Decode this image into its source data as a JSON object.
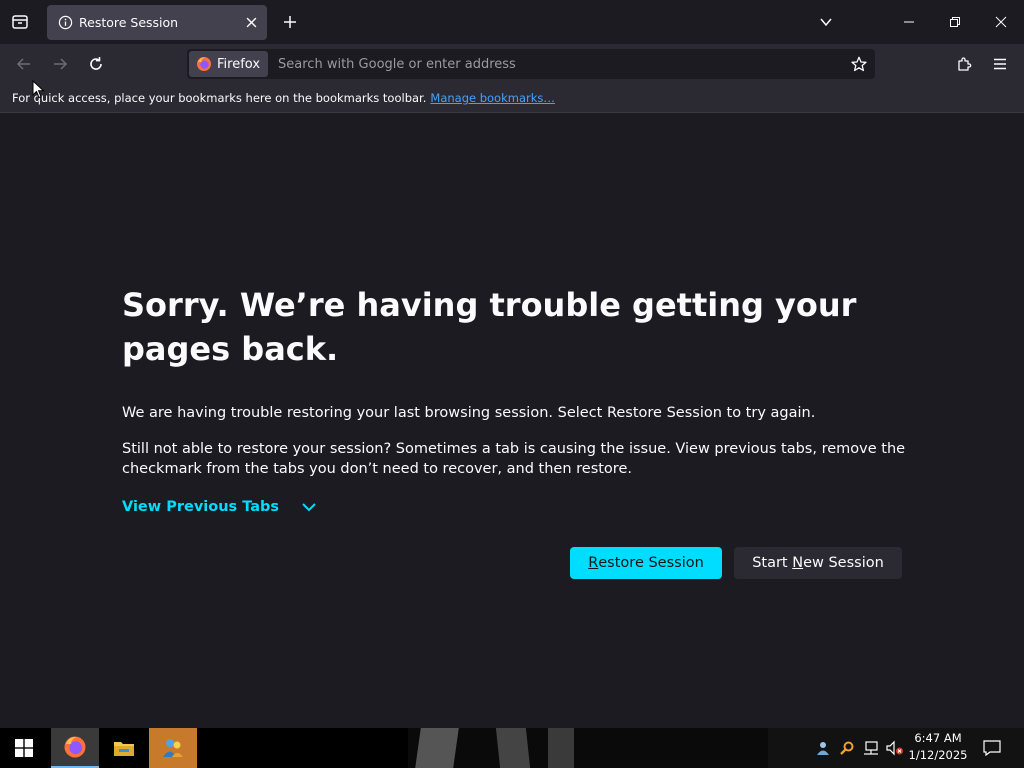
{
  "tab": {
    "title": "Restore Session"
  },
  "urlbar": {
    "identity_label": "Firefox",
    "placeholder": "Search with Google or enter address"
  },
  "bookmarks_bar": {
    "message": "For quick access, place your bookmarks here on the bookmarks toolbar.",
    "link": "Manage bookmarks…"
  },
  "page": {
    "title": "Sorry. We’re having trouble getting your pages back.",
    "paragraph1": "We are having trouble restoring your last browsing session. Select Restore Session to try again.",
    "paragraph2": "Still not able to restore your session? Sometimes a tab is causing the issue. View previous tabs, remove the checkmark from the tabs you don’t need to recover, and then restore.",
    "view_previous": "View Previous Tabs",
    "restore_button": {
      "accesskey": "R",
      "rest": "estore Session"
    },
    "new_session_button": {
      "before": "Start ",
      "accesskey": "N",
      "rest": "ew Session"
    }
  },
  "taskbar": {
    "time": "6:47 AM",
    "date": "1/12/2025"
  },
  "colors": {
    "accent": "#00ddff",
    "link": "#45a1ff",
    "background": "#1c1b22",
    "toolbar": "#2b2a33",
    "tab_selected": "#42414d"
  },
  "icons": {
    "tablist": "tab-list-icon",
    "tab": "info-icon",
    "close": "close-icon",
    "new_tab": "plus-icon",
    "back": "back-arrow-icon",
    "forward": "forward-arrow-icon",
    "reload": "reload-icon",
    "identity": "firefox-logo-icon",
    "bookmark": "star-icon",
    "extensions": "puzzle-icon",
    "menu": "hamburger-icon"
  }
}
